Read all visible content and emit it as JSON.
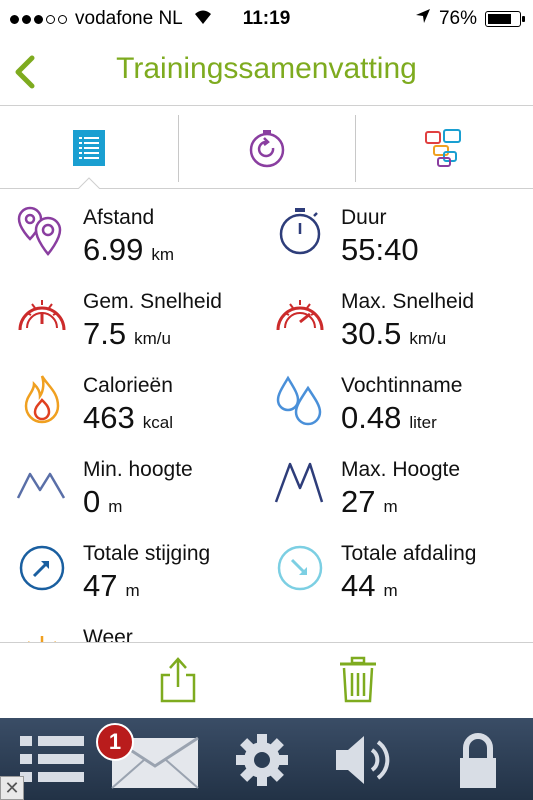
{
  "status_bar": {
    "carrier": "vodafone NL",
    "time": "11:19",
    "battery": "76%",
    "battery_level": 0.76
  },
  "nav": {
    "title": "Trainingssamenvatting"
  },
  "tabs": [
    {
      "icon": "list-icon",
      "selected": true
    },
    {
      "icon": "stopwatch-replay-icon",
      "selected": false
    },
    {
      "icon": "chat-bubbles-icon",
      "selected": false
    }
  ],
  "stats": [
    {
      "label": "Afstand",
      "value": "6.99",
      "unit": "km",
      "icon": "location-pins-icon"
    },
    {
      "label": "Duur",
      "value": "55:40",
      "unit": "",
      "icon": "stopwatch-icon"
    },
    {
      "label": "Gem. Snelheid",
      "value": "7.5",
      "unit": "km/u",
      "icon": "speedometer-icon"
    },
    {
      "label": "Max. Snelheid",
      "value": "30.5",
      "unit": "km/u",
      "icon": "speedometer-max-icon"
    },
    {
      "label": "Calorieën",
      "value": "463",
      "unit": "kcal",
      "icon": "flame-icon"
    },
    {
      "label": "Vochtinname",
      "value": "0.48",
      "unit": "liter",
      "icon": "water-drops-icon"
    },
    {
      "label": "Min. hoogte",
      "value": "0",
      "unit": "m",
      "icon": "mountain-low-icon"
    },
    {
      "label": "Max. Hoogte",
      "value": "27",
      "unit": "m",
      "icon": "mountain-high-icon"
    },
    {
      "label": "Totale stijging",
      "value": "47",
      "unit": "m",
      "icon": "ascent-arrow-icon"
    },
    {
      "label": "Totale afdaling",
      "value": "44",
      "unit": "m",
      "icon": "descent-arrow-icon"
    },
    {
      "label": "Weer",
      "value": "",
      "unit": "",
      "icon": "sun-icon"
    }
  ],
  "actions": {
    "share_icon": "share-icon",
    "delete_icon": "trash-icon"
  },
  "bottom_bar": {
    "items": [
      "menu-icon",
      "mail-icon",
      "settings-icon",
      "sound-icon",
      "lock-icon"
    ],
    "mail_badge": "1"
  },
  "colors": {
    "accent_green": "#7eab1f",
    "tab_blue": "#1a9fd1",
    "purple": "#8a3ea0",
    "red": "#cc2b2b",
    "orange": "#f0a020",
    "navy": "#2e3d7a"
  }
}
